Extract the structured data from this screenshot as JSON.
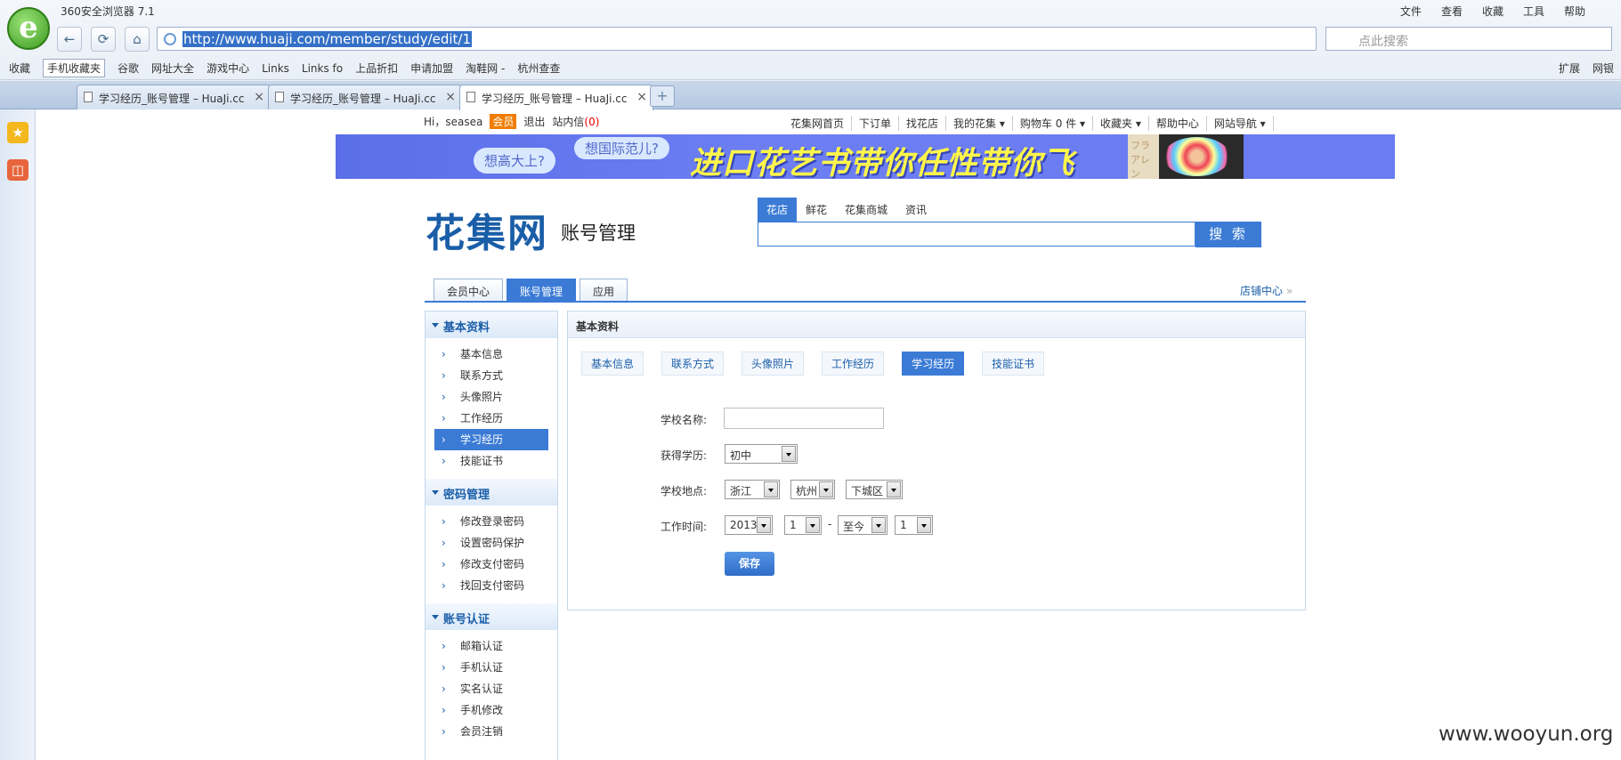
{
  "window": {
    "title": "360安全浏览器 7.1",
    "menu": [
      "文件",
      "查看",
      "收藏",
      "工具",
      "帮助"
    ]
  },
  "address": {
    "url": "http://www.huaji.com/member/study/edit/1"
  },
  "search": {
    "placeholder": "点此搜索"
  },
  "bookmarks": {
    "items": [
      "收藏",
      "手机收藏夹",
      "谷歌",
      "网址大全",
      "游戏中心",
      "Links",
      "Links fo",
      "上品折扣",
      "申请加盟",
      "淘鞋网 -",
      "杭州查查"
    ],
    "right": [
      "扩展",
      "网银"
    ]
  },
  "tabs": [
    {
      "label": "学习经历_账号管理 – HuaJi.cc"
    },
    {
      "label": "学习经历_账号管理 – HuaJi.cc"
    },
    {
      "label": "学习经历_账号管理 – HuaJi.cc"
    }
  ],
  "topbar": {
    "hi": "Hi，",
    "user": "seasea",
    "badge": "会员",
    "logout": "退出",
    "inbox": "站内信",
    "inbox_count": "(0)"
  },
  "sitenav": [
    "花集网首页",
    "下订单",
    "找花店",
    "我的花集 ▾",
    "购物车 0 件 ▾",
    "收藏夹 ▾",
    "帮助中心",
    "网站导航 ▾"
  ],
  "banner": {
    "bubble1": "想高大上?",
    "bubble2": "想国际范儿?",
    "headline": "进口花艺书带你任性带你飞",
    "photo_text": "フラ アレン"
  },
  "brand": {
    "name": "花集网",
    "sub": "账号管理"
  },
  "searchtabs": [
    "花店",
    "鲜花",
    "花集商城",
    "资讯"
  ],
  "search_button": "搜 索",
  "maintabs": [
    "会员中心",
    "账号管理",
    "应用"
  ],
  "shop_center": "店铺中心",
  "leftnav": [
    {
      "title": "基本资料",
      "items": [
        "基本信息",
        "联系方式",
        "头像照片",
        "工作经历",
        "学习经历",
        "技能证书"
      ]
    },
    {
      "title": "密码管理",
      "items": [
        "修改登录密码",
        "设置密码保护",
        "修改支付密码",
        "找回支付密码"
      ]
    },
    {
      "title": "账号认证",
      "items": [
        "邮箱认证",
        "手机认证",
        "实名认证",
        "手机修改",
        "会员注销"
      ]
    }
  ],
  "content": {
    "title": "基本资料",
    "subtabs": [
      "基本信息",
      "联系方式",
      "头像照片",
      "工作经历",
      "学习经历",
      "技能证书"
    ],
    "labels": {
      "school": "学校名称:",
      "degree": "获得学历:",
      "location": "学校地点:",
      "time": "工作时间:"
    },
    "values": {
      "school": "",
      "degree": "初中",
      "province": "浙江",
      "city": "杭州",
      "district": "下城区",
      "start_year": "2013",
      "start_month": "1",
      "end_year": "至今",
      "end_month": "1",
      "dash": "-"
    },
    "save": "保存"
  },
  "watermark": "www.wooyun.org",
  "colors": {
    "accent": "#3b7bd6",
    "brand": "#1a5ea8"
  }
}
